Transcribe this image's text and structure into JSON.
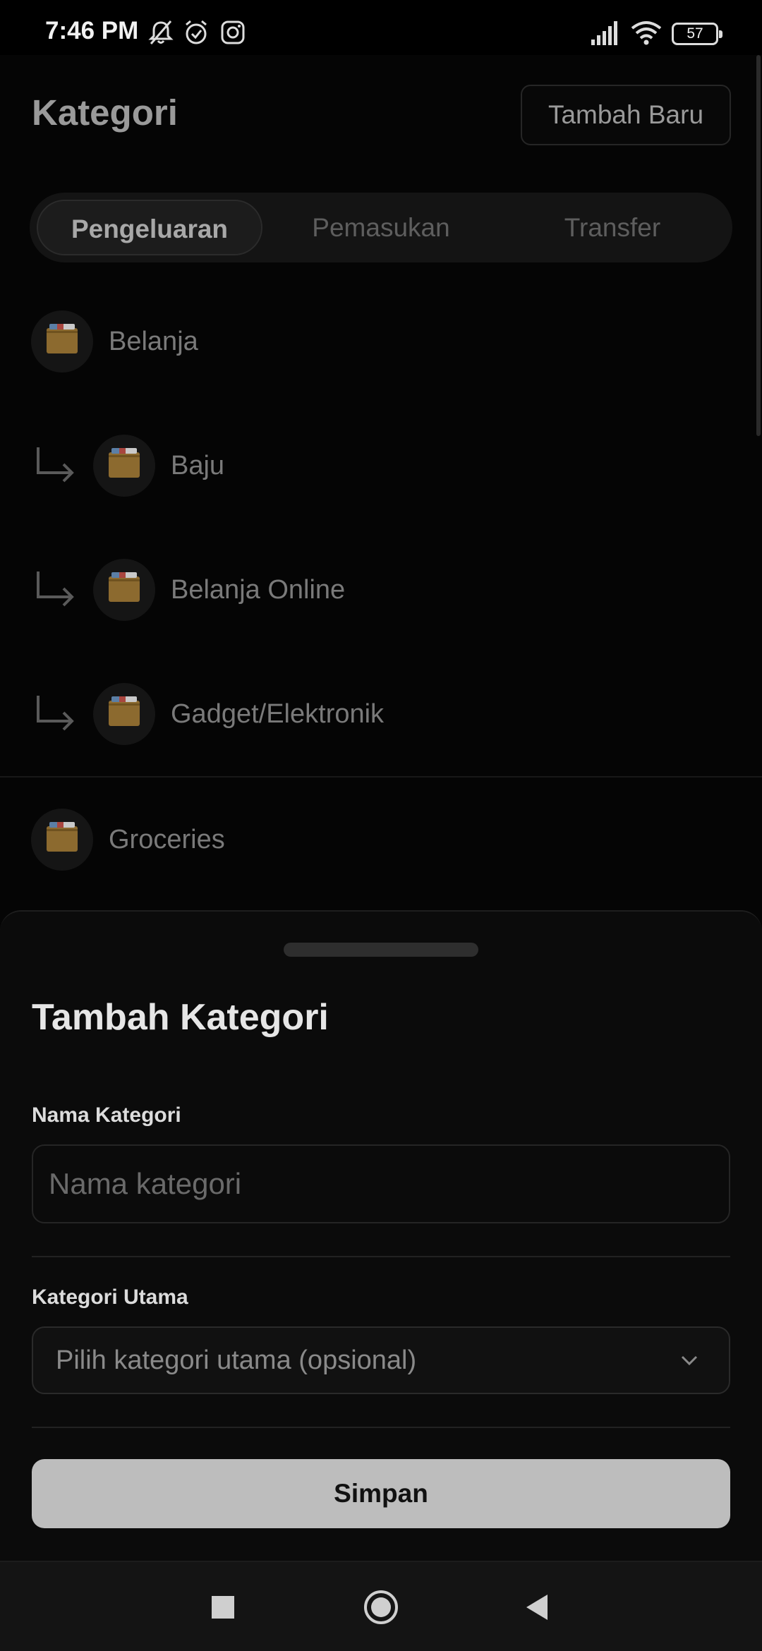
{
  "status_bar": {
    "time": "7:46 PM",
    "icons": [
      "notifications-muted-icon",
      "alarm-icon",
      "instagram-icon",
      "signal-icon",
      "wifi-icon"
    ],
    "battery": "57"
  },
  "page": {
    "title": "Kategori",
    "add_button": "Tambah Baru",
    "tabs": [
      {
        "label": "Pengeluaran",
        "active": true
      },
      {
        "label": "Pemasukan",
        "active": false
      },
      {
        "label": "Transfer",
        "active": false
      }
    ],
    "categories": [
      {
        "label": "Belanja",
        "sub": false
      },
      {
        "label": "Baju",
        "sub": true
      },
      {
        "label": "Belanja Online",
        "sub": true
      },
      {
        "label": "Gadget/Elektronik",
        "sub": true
      },
      {
        "label": "Groceries",
        "sub": false
      }
    ]
  },
  "sheet": {
    "title": "Tambah Kategori",
    "name_label": "Nama Kategori",
    "name_placeholder": "Nama kategori",
    "name_value": "",
    "parent_label": "Kategori Utama",
    "parent_placeholder": "Pilih kategori utama (opsional)",
    "save_button": "Simpan"
  },
  "navbar": {
    "buttons": [
      "recents-icon",
      "home-icon",
      "back-icon"
    ]
  },
  "colors": {
    "background": "#050505",
    "sheet": "#0b0b0b",
    "save_button": "#bdbdbd",
    "folder": "#8c6a2f"
  }
}
